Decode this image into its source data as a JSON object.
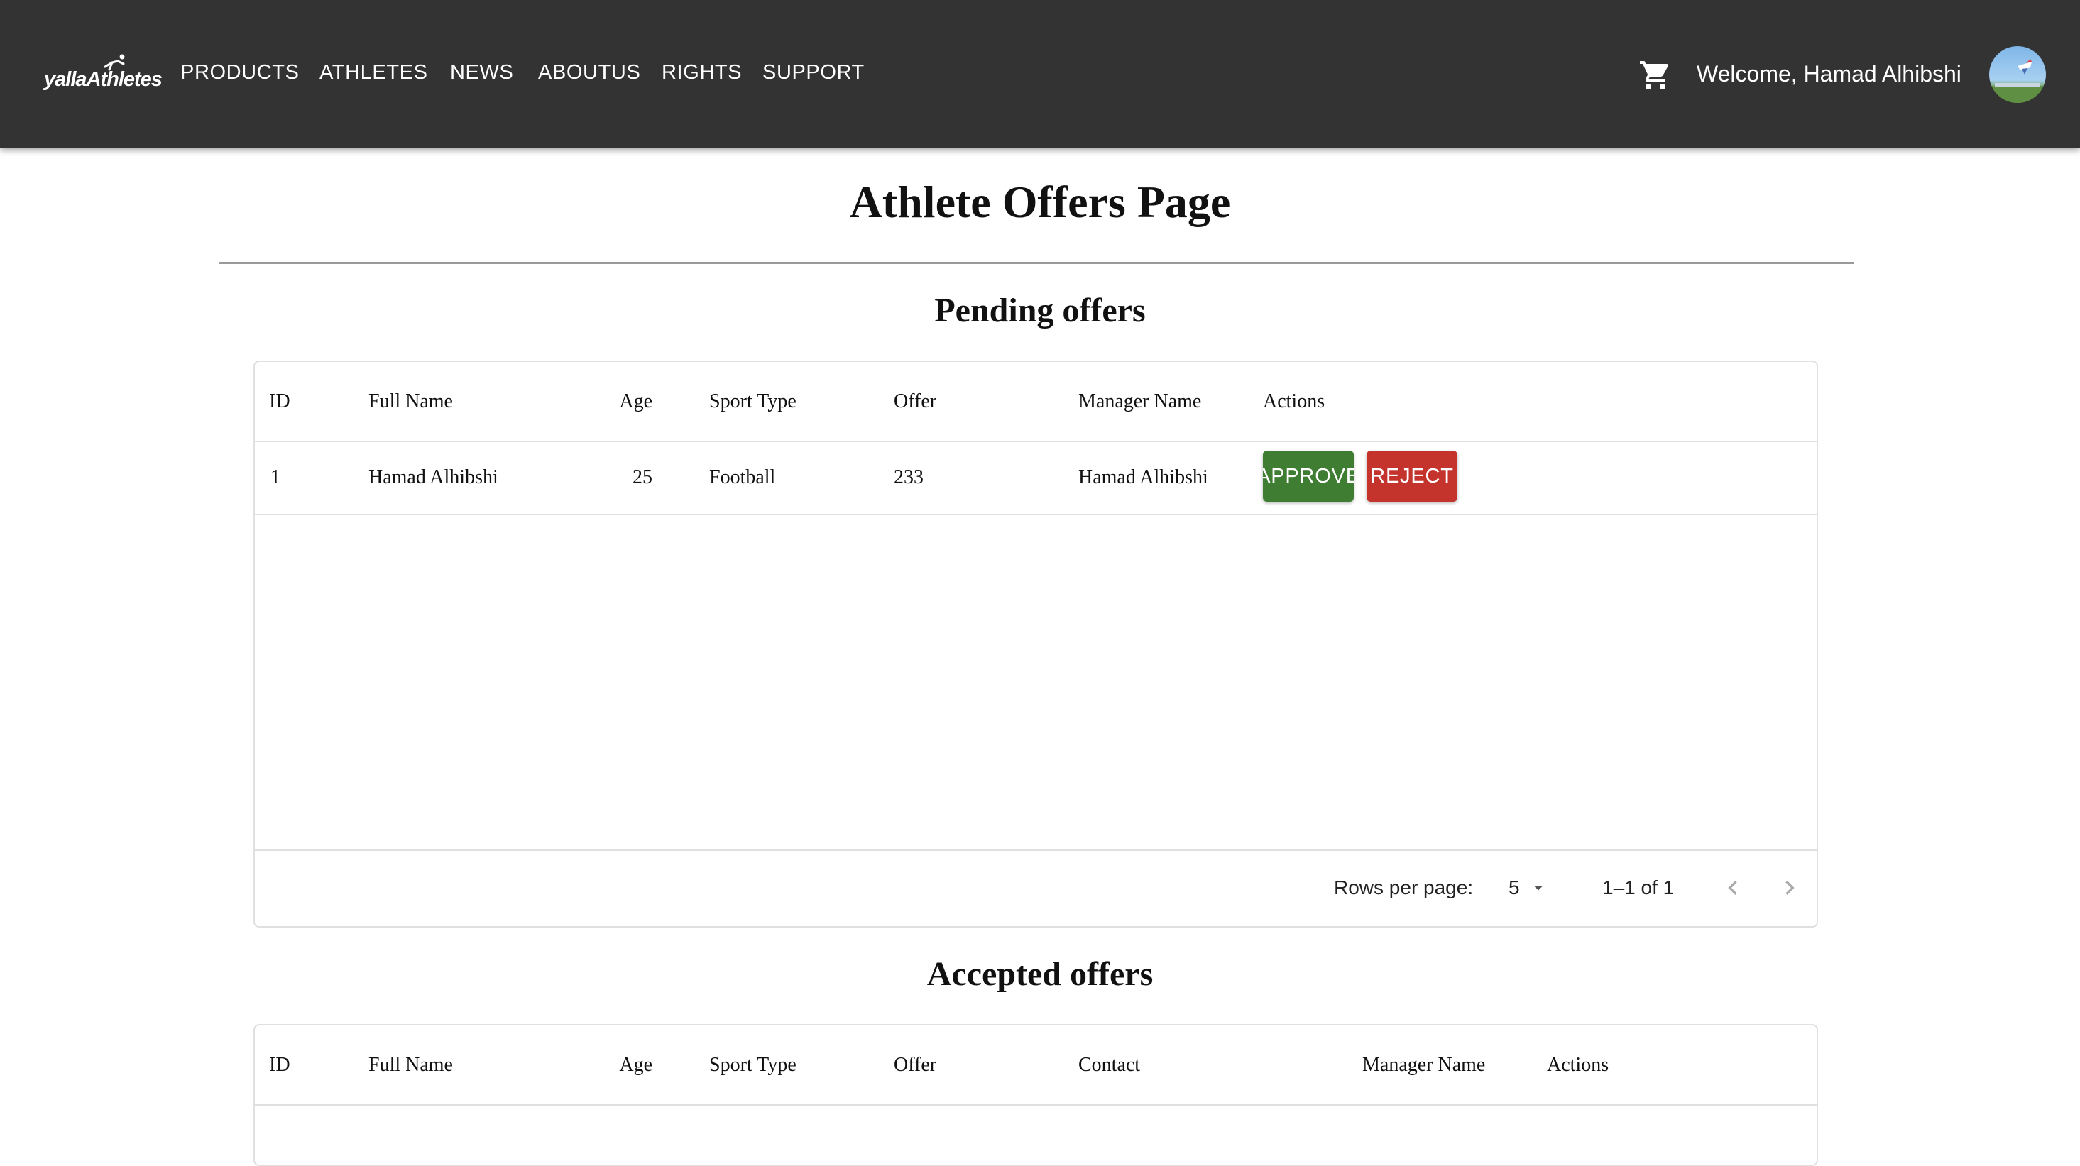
{
  "appbar": {
    "logo_text": "yallaAthletes",
    "nav": [
      "PRODUCTS",
      "ATHLETES",
      "NEWS",
      "ABOUTUS",
      "RIGHTS",
      "SUPPORT"
    ],
    "welcome": "Welcome, Hamad Alhibshi",
    "icons": [
      "cart-icon",
      "avatar"
    ]
  },
  "page_title": "Athlete Offers Page",
  "pending": {
    "title": "Pending offers",
    "columns": [
      "ID",
      "Full Name",
      "Age",
      "Sport Type",
      "Offer",
      "Manager Name",
      "Actions"
    ],
    "rows": [
      {
        "id": "1",
        "full_name": "Hamad Alhibshi",
        "age": "25",
        "sport": "Football",
        "offer": "233",
        "manager": "Hamad Alhibshi"
      }
    ],
    "approve_label": "APPROVE",
    "reject_label": "REJECT",
    "footer": {
      "rows_per_page_label": "Rows per page:",
      "rows_per_page_value": "5",
      "range": "1–1 of 1"
    }
  },
  "accepted": {
    "title": "Accepted offers",
    "columns": [
      "ID",
      "Full Name",
      "Age",
      "Sport Type",
      "Offer",
      "Contact",
      "Manager Name",
      "Actions"
    ]
  },
  "colors": {
    "appbar": "#333333",
    "approve": "#3f7d32",
    "reject": "#c4342d"
  }
}
